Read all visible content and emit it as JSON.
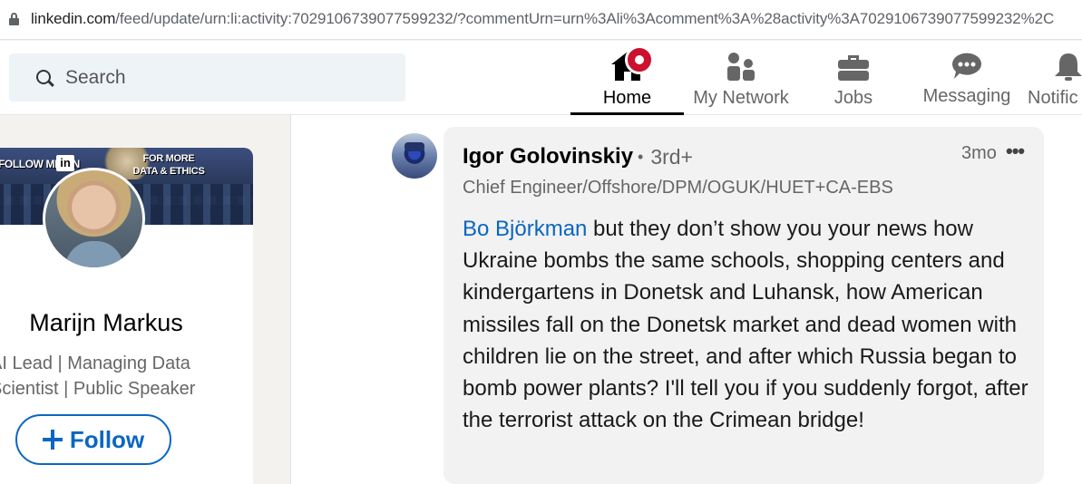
{
  "browser": {
    "url_domain": "linkedin.com",
    "url_path": "/feed/update/urn:li:activity:7029106739077599232/?commentUrn=urn%3Ali%3Acomment%3A%28activity%3A7029106739077599232%2C"
  },
  "search": {
    "placeholder": "Search"
  },
  "nav": {
    "home": "Home",
    "network": "My Network",
    "jobs": "Jobs",
    "messaging": "Messaging",
    "notifications": "Notific"
  },
  "profile": {
    "banner_left": "FOLLOW ME ON",
    "banner_logo": "in",
    "banner_right": "FOR MORE DATA & ETHICS",
    "name": "Marijn Markus",
    "headline_line1": "AI Lead | Managing Data",
    "headline_line2": "Scientist | Public Speaker",
    "follow_label": "Follow"
  },
  "comment": {
    "author": "Igor Golovinskiy",
    "degree": "3rd+",
    "time": "3mo",
    "more": "•••",
    "author_title": "Chief Engineer/Offshore/DPM/OGUK/HUET+CA-EBS",
    "mention": "Bo Björkman",
    "text": " but they don’t show you your news how Ukraine bombs the same schools, shopping centers and kindergartens in Donetsk and Luhansk, how American missiles fall on the Donetsk market and dead women with children lie on the street, and after which Russia began to bomb power plants? I'll tell you if you suddenly forgot, after the terrorist attack on the Crimean bridge!"
  },
  "colors": {
    "accent": "#0a66c2",
    "notification_badge": "#cb112d",
    "comment_bg": "#f2f2f2"
  },
  "icons": [
    "lock-icon",
    "search-icon",
    "home-icon",
    "my-network-icon",
    "jobs-icon",
    "messaging-icon",
    "notifications-icon",
    "plus-icon",
    "more-options-icon"
  ]
}
